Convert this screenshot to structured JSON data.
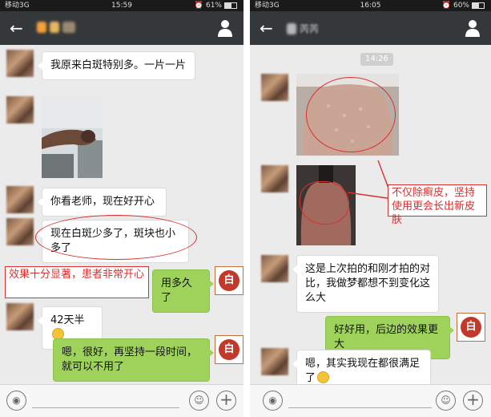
{
  "left": {
    "status": {
      "carrier": "移动3G",
      "time": "15:59",
      "battery": "61%"
    },
    "messages": [
      {
        "text": "我原来白斑特别多。一片一片"
      },
      {
        "text": "你看老师，现在好开心"
      },
      {
        "text": "现在白斑少多了，斑块也小多了"
      },
      {
        "text": "用多久了"
      },
      {
        "text": "42天半"
      },
      {
        "text": "嗯，很好，再坚持一段时间，就可以不用了"
      }
    ],
    "annotation": "效果十分显著，患者非常开心"
  },
  "right": {
    "status": {
      "carrier": "移动3G",
      "time": "16:05",
      "battery": "60%"
    },
    "title_blur_text": "芮芮",
    "timestamp": "14:26",
    "messages": [
      {
        "text": "这是上次拍的和刚才拍的对比，我做梦都想不到变化这么大"
      },
      {
        "text": "好好用，后边的效果更大"
      },
      {
        "text": "嗯，其实我现在都很满足了"
      }
    ],
    "annotation": "不仅除癣皮，坚持使用更会长出新皮肤"
  },
  "doctor_logo_char": "白",
  "colors": {
    "accent": "#d93030",
    "outgoing": "#9ed25b",
    "titlebar": "#35383b"
  }
}
